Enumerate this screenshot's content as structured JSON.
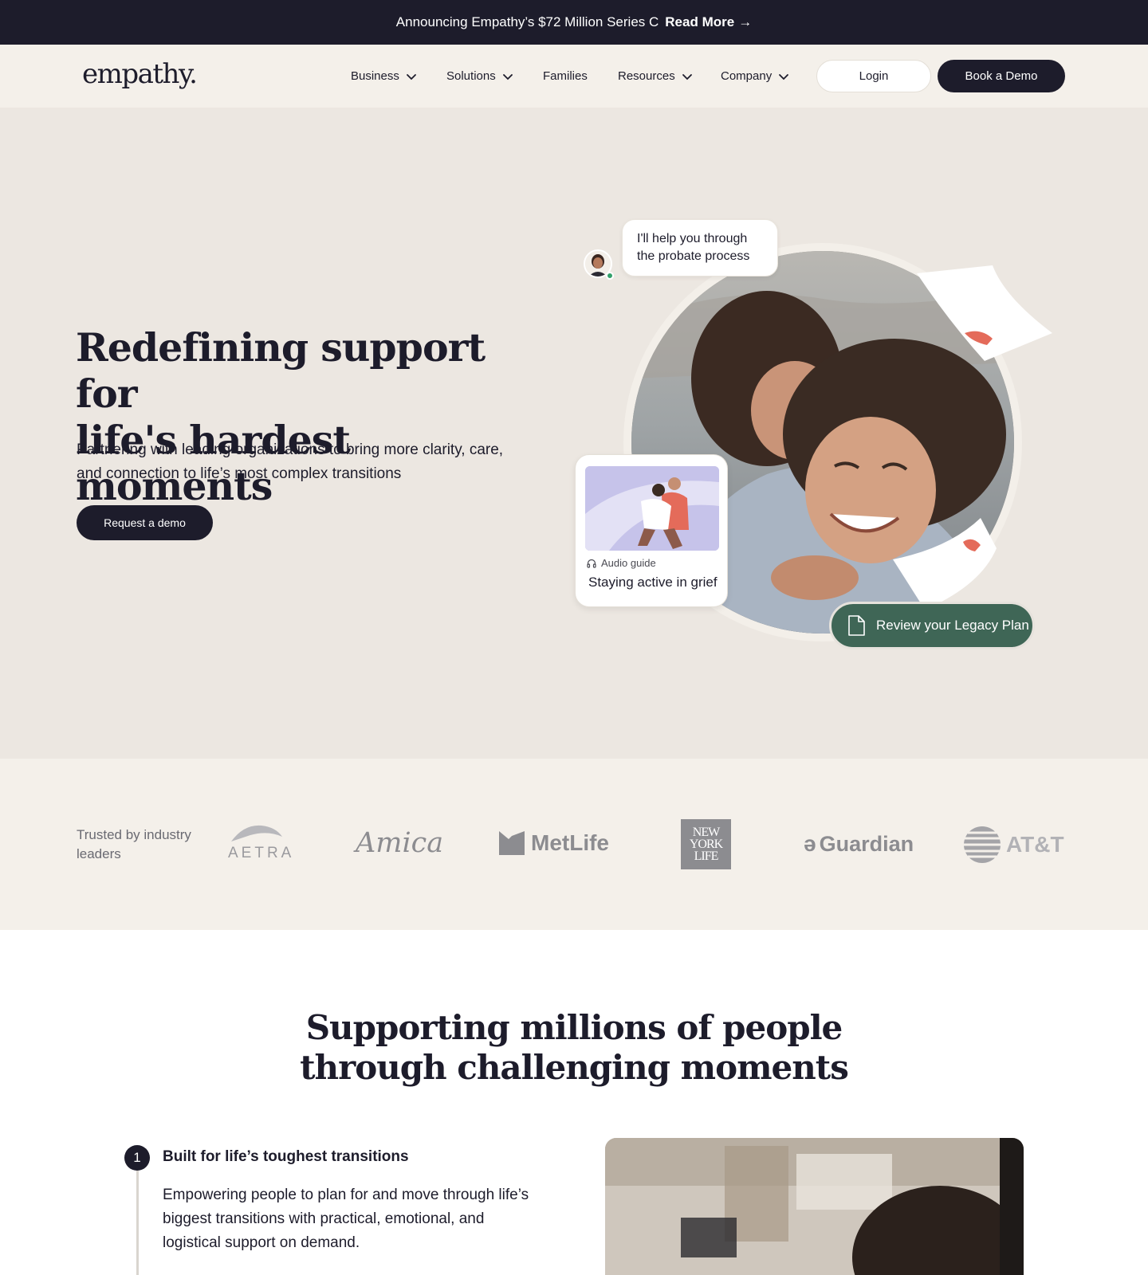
{
  "announcement": {
    "text": "Announcing Empathy’s $72 Million Series C",
    "link_label": "Read More",
    "arrow": "→"
  },
  "header": {
    "logo": "empathy.",
    "nav": [
      {
        "label": "Business",
        "has_dropdown": true
      },
      {
        "label": "Solutions",
        "has_dropdown": true
      },
      {
        "label": "Families",
        "has_dropdown": false
      },
      {
        "label": "Resources",
        "has_dropdown": true
      },
      {
        "label": "Company",
        "has_dropdown": true
      }
    ],
    "login_label": "Login",
    "demo_label": "Book a Demo"
  },
  "hero": {
    "title_line1": "Redefining support for",
    "title_line2": "life's hardest moments",
    "subtitle_line1": "Partnering with leading organizations to bring more clarity, care,",
    "subtitle_line2": "and connection to life’s most complex transitions",
    "cta_label": "Request a demo",
    "chat_line1": "I'll help you through",
    "chat_line2": "the probate process",
    "audio_card": {
      "label": "Audio guide",
      "title": "Staying active in grief"
    },
    "legacy_button": "Review your Legacy Plan"
  },
  "trusted": {
    "label_line1": "Trusted by industry",
    "label_line2": "leaders",
    "logos": {
      "aetra": "AETRA",
      "amica": "Amica",
      "metlife": "MetLife",
      "nyl_line1": "NEW",
      "nyl_line2": "YORK",
      "nyl_line3": "LIFE",
      "guardian": "Guardian",
      "att": "AT&T"
    }
  },
  "support": {
    "title_line1": "Supporting millions of people",
    "title_line2": "through challenging moments",
    "step": {
      "number": "1",
      "title": "Built for life’s toughest transitions",
      "body": "Empowering people to plan for and move through life’s biggest transitions with practical, emotional, and logistical support on demand."
    }
  },
  "colors": {
    "navy": "#1d1c2b",
    "cream": "#f4f0ea",
    "hero_bg": "#ece7e1",
    "green_button": "#3f6656",
    "online": "#33a06b",
    "accent_coral": "#e46b5a"
  }
}
